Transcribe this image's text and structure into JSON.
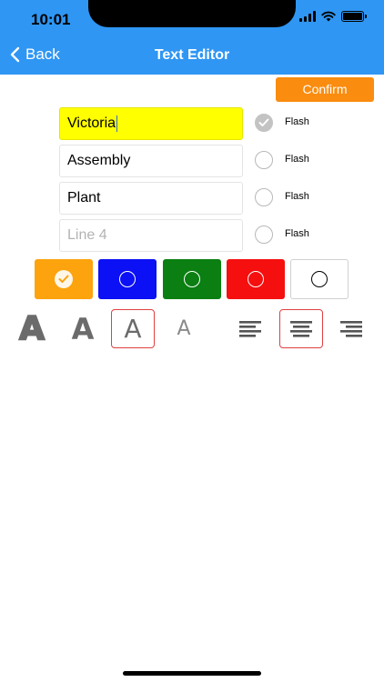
{
  "status_bar": {
    "time": "10:01"
  },
  "nav": {
    "back_label": "Back",
    "title": "Text Editor"
  },
  "toolbar": {
    "confirm_label": "Confirm"
  },
  "lines": [
    {
      "value": "Victoria",
      "placeholder": "",
      "flash_label": "Flash",
      "flash_checked": true,
      "highlight_color": "#ffff00"
    },
    {
      "value": "Assembly",
      "placeholder": "",
      "flash_label": "Flash",
      "flash_checked": false
    },
    {
      "value": "Plant",
      "placeholder": "",
      "flash_label": "Flash",
      "flash_checked": false
    },
    {
      "value": "",
      "placeholder": "Line 4",
      "flash_label": "Flash",
      "flash_checked": false
    }
  ],
  "colors": [
    {
      "name": "orange",
      "hex": "#fca30d",
      "selected": true
    },
    {
      "name": "blue",
      "hex": "#0b10f5",
      "selected": false
    },
    {
      "name": "green",
      "hex": "#0b7f12",
      "selected": false
    },
    {
      "name": "red",
      "hex": "#f50f0f",
      "selected": false
    },
    {
      "name": "white",
      "hex": "#ffffff",
      "selected": false
    }
  ],
  "font_styles": [
    {
      "glyph": "A",
      "name": "extra-bold"
    },
    {
      "glyph": "A",
      "name": "bold"
    },
    {
      "glyph": "A",
      "name": "regular",
      "selected": true
    },
    {
      "glyph": "A",
      "name": "light"
    }
  ],
  "alignments": [
    {
      "name": "left"
    },
    {
      "name": "center",
      "selected": true
    },
    {
      "name": "right"
    }
  ],
  "theme": {
    "header": "#2f96f3",
    "confirm": "#fa8c0f",
    "selected_outline": "#e04040"
  }
}
